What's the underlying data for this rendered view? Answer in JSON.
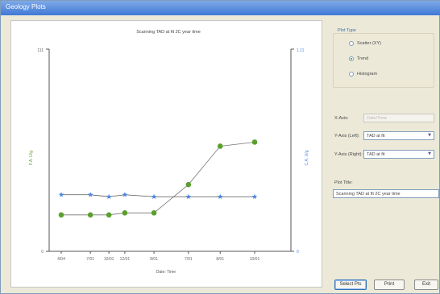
{
  "window": {
    "title": "Geology Plots"
  },
  "plot": {
    "title": "Scanning TAD at fit 2C year time",
    "y_left_label": "F.A. U/g",
    "y_right_label": "C.A. U/g",
    "y_left_top": "111",
    "y_left_bottom": "0",
    "y_right_top": "1.11",
    "y_right_bottom": "0",
    "xlabel": "Date: Time"
  },
  "chart_data": {
    "type": "line",
    "x_ticks": [
      "4/04",
      "7/01",
      "10/01",
      "12/01",
      "8/01",
      "7/01",
      "8/01",
      "10/01"
    ],
    "series": [
      {
        "color": "#5aa02c",
        "marker": "circle",
        "values": [
          0.18,
          0.18,
          0.18,
          0.19,
          0.19,
          0.33,
          0.52,
          0.54
        ]
      },
      {
        "color": "#4a86e8",
        "marker": "star",
        "values": [
          0.28,
          0.28,
          0.27,
          0.28,
          0.27,
          0.27,
          0.27,
          0.27
        ]
      }
    ],
    "x_positions": [
      0.0,
      0.11,
      0.18,
      0.24,
      0.35,
      0.48,
      0.6,
      0.73
    ],
    "ylim": [
      0,
      1
    ]
  },
  "plot_type": {
    "title": "Plot Type",
    "options": [
      {
        "label": "Scatter (XY)",
        "selected": false
      },
      {
        "label": "Trend",
        "selected": true
      },
      {
        "label": "Histogram",
        "selected": false
      }
    ]
  },
  "axes": {
    "x_axis": {
      "label": "X-Axis:",
      "value": "Date/Time"
    },
    "y_left": {
      "label": "Y-Axis (Left):",
      "value": "TAD at fit"
    },
    "y_right": {
      "label": "Y-Axis (Right):",
      "value": "TAD at fit"
    }
  },
  "plot_title_field": {
    "label": "Plot Title:",
    "value": "Scanning TAD at fit 2C year time"
  },
  "buttons": {
    "select_pts": "Select Pts",
    "print": "Print",
    "exit": "Exit"
  }
}
